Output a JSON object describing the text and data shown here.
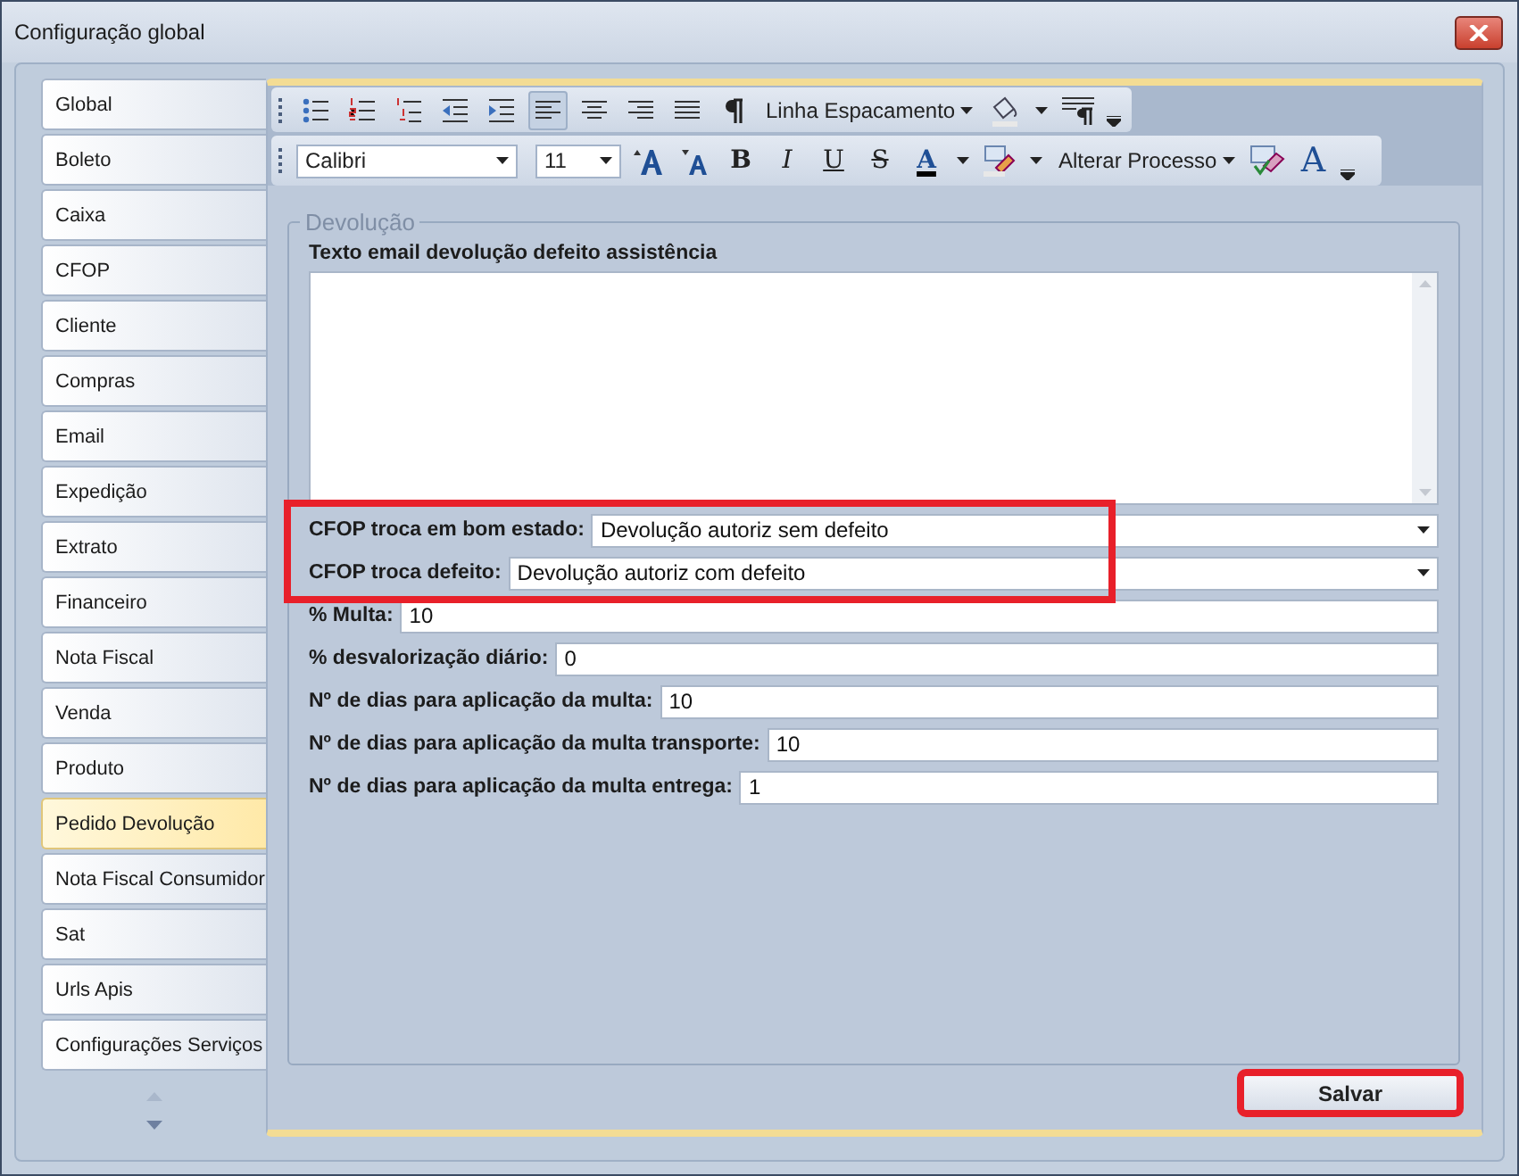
{
  "window": {
    "title": "Configuração global"
  },
  "sidebar": {
    "items": [
      {
        "label": "Global",
        "selected": false
      },
      {
        "label": "Boleto",
        "selected": false
      },
      {
        "label": "Caixa",
        "selected": false
      },
      {
        "label": "CFOP",
        "selected": false
      },
      {
        "label": "Cliente",
        "selected": false
      },
      {
        "label": "Compras",
        "selected": false
      },
      {
        "label": "Email",
        "selected": false
      },
      {
        "label": "Expedição",
        "selected": false
      },
      {
        "label": "Extrato",
        "selected": false
      },
      {
        "label": "Financeiro",
        "selected": false
      },
      {
        "label": "Nota Fiscal",
        "selected": false
      },
      {
        "label": "Venda",
        "selected": false
      },
      {
        "label": "Produto",
        "selected": false
      },
      {
        "label": "Pedido Devolução",
        "selected": true
      },
      {
        "label": "Nota Fiscal Consumidor",
        "selected": false
      },
      {
        "label": "Sat",
        "selected": false
      },
      {
        "label": "Urls Apis",
        "selected": false
      },
      {
        "label": "Configurações Serviços",
        "selected": false
      }
    ]
  },
  "toolbars": [
    {
      "items": [
        {
          "kind": "icon",
          "pressed": false
        },
        {
          "kind": "icon",
          "pressed": false
        },
        {
          "kind": "icon",
          "pressed": false
        },
        {
          "kind": "icon",
          "pressed": false
        },
        {
          "kind": "icon",
          "pressed": false
        },
        {
          "kind": "icon",
          "pressed": true
        },
        {
          "kind": "icon",
          "pressed": false
        },
        {
          "kind": "icon",
          "pressed": false
        },
        {
          "kind": "icon",
          "pressed": false
        },
        {
          "kind": "icon",
          "pressed": false
        },
        {
          "kind": "menu",
          "label": "Linha Espacamento"
        },
        {
          "kind": "icon",
          "pressed": false
        },
        {
          "kind": "caret"
        },
        {
          "kind": "icon",
          "pressed": false
        }
      ]
    },
    {
      "items": [
        {
          "kind": "combo",
          "value": "Calibri"
        },
        {
          "kind": "combo",
          "value": "11"
        },
        {
          "kind": "icon",
          "pressed": false
        },
        {
          "kind": "icon",
          "pressed": false
        },
        {
          "kind": "glyph",
          "label": "B"
        },
        {
          "kind": "glyph",
          "label": "I"
        },
        {
          "kind": "glyph",
          "label": "U"
        },
        {
          "kind": "glyph",
          "label": "S"
        },
        {
          "kind": "glyph",
          "label": "A"
        },
        {
          "kind": "caret"
        },
        {
          "kind": "icon",
          "pressed": false
        },
        {
          "kind": "caret"
        },
        {
          "kind": "menu",
          "label": "Alterar Processo"
        },
        {
          "kind": "icon",
          "pressed": false
        },
        {
          "kind": "glyph",
          "label": "A"
        }
      ]
    }
  ],
  "group": {
    "title": "Devolução",
    "textarea": {
      "label": "Texto email devolução defeito assistência"
    },
    "fields": [
      {
        "kind": "dropdown",
        "label": "CFOP troca em bom estado:",
        "value": "Devolução autoriz sem defeito",
        "highlighted": true
      },
      {
        "kind": "dropdown",
        "label": "CFOP troca defeito:",
        "value": "Devolução autoriz com defeito",
        "highlighted": true
      },
      {
        "kind": "text",
        "label": "% Multa:",
        "value": "10",
        "highlighted": false
      },
      {
        "kind": "text",
        "label": "% desvalorização diário:",
        "value": "0",
        "highlighted": false
      },
      {
        "kind": "text",
        "label": "Nº de dias para aplicação da multa:",
        "value": "10",
        "highlighted": false
      },
      {
        "kind": "text",
        "label": "Nº de dias para aplicação da multa transporte:",
        "value": "10",
        "highlighted": false
      },
      {
        "kind": "text",
        "label": "Nº de dias para aplicação da multa entrega:",
        "value": "1",
        "highlighted": false
      }
    ]
  },
  "save_button": {
    "label": "Salvar",
    "highlighted": true
  }
}
